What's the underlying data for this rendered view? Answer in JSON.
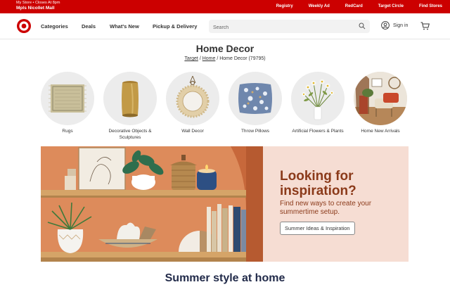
{
  "topbar": {
    "store_hours": "My Store • Closes At 8pm",
    "store_name": "Mpls Nicollet Mall",
    "links": [
      "Registry",
      "Weekly Ad",
      "RedCard",
      "Target Circle",
      "Find Stores"
    ]
  },
  "header": {
    "nav": [
      "Categories",
      "Deals",
      "What's New",
      "Pickup & Delivery"
    ],
    "search_placeholder": "Search",
    "signin_label": "Sign in"
  },
  "page": {
    "title": "Home Decor",
    "breadcrumb": {
      "root": "Target",
      "parent": "Home",
      "current": "Home Decor (79795)"
    }
  },
  "categories": [
    {
      "label": "Rugs"
    },
    {
      "label": "Decorative Objects & Sculptures"
    },
    {
      "label": "Wall Decor"
    },
    {
      "label": "Throw Pillows"
    },
    {
      "label": "Artificial Flowers & Plants"
    },
    {
      "label": "Home New Arrivals"
    }
  ],
  "hero": {
    "heading": "Looking for inspiration?",
    "subtext": "Find new ways to create your summertime setup.",
    "button": "Summer Ideas & Inspiration"
  },
  "section_title": "Summer style at home",
  "colors": {
    "brand_red": "#cc0000",
    "hero_text": "#8b3a1a",
    "hero_bg": "#f6ddd3"
  }
}
